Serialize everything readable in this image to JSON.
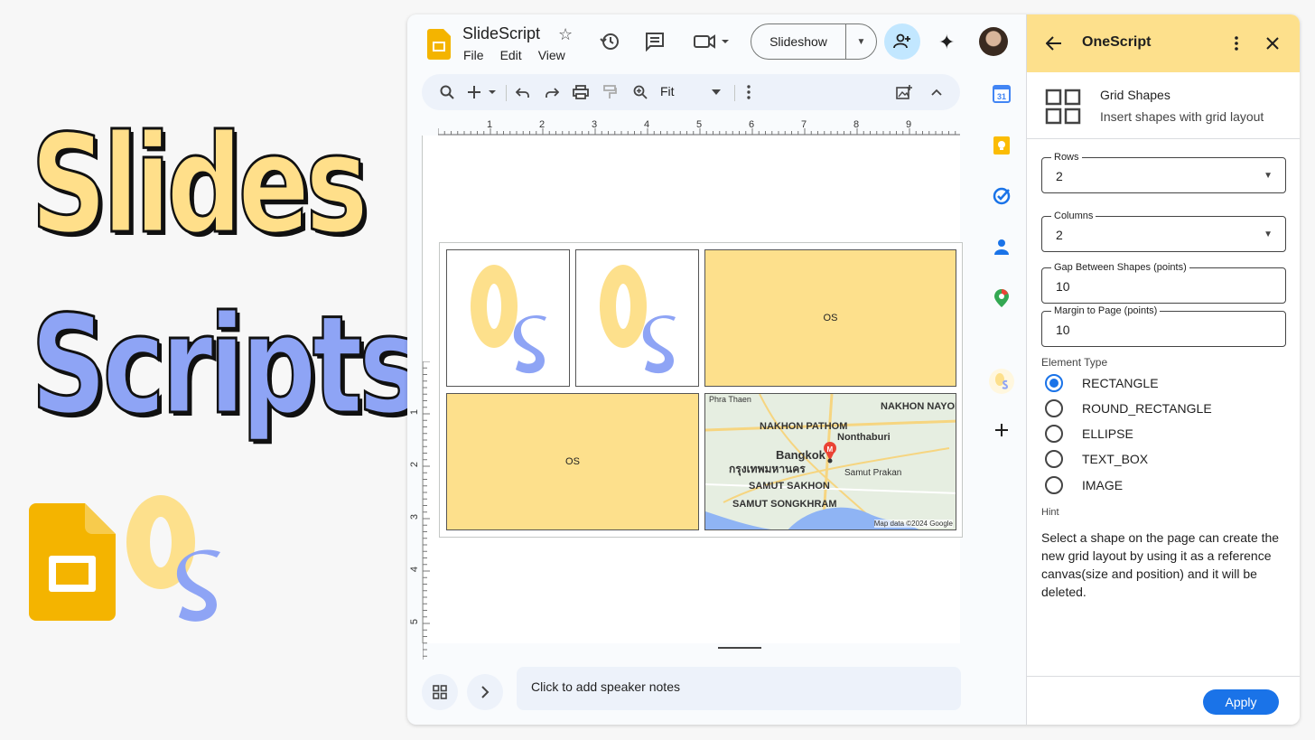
{
  "promo": {
    "word1": "Slides",
    "word2": "Scripts",
    "colors": {
      "yellow": "#ffdf8a",
      "blue": "#8ea4f5"
    }
  },
  "app": {
    "doc_title": "SlideScript",
    "menus": [
      "File",
      "Edit",
      "View"
    ],
    "slideshow_label": "Slideshow",
    "zoom_label": "Fit",
    "ruler_h": [
      "1",
      "2",
      "3",
      "4",
      "5",
      "6",
      "7",
      "8",
      "9"
    ],
    "ruler_v": [
      "1",
      "2",
      "3",
      "4",
      "5"
    ],
    "notes_placeholder": "Click to add speaker notes"
  },
  "slide": {
    "shape_text": "OS",
    "map": {
      "labels": [
        "Phra Thaen",
        "NAKHON PATHOM",
        "NAKHON NAYOK",
        "Nonthaburi",
        "Bangkok",
        "กรุงเทพมหานคร",
        "Samut Prakan",
        "SAMUT SAKHON",
        "SAMUT SONGKHRAM"
      ],
      "credit": "Map data ©2024 Google"
    }
  },
  "panel": {
    "title": "OneScript",
    "tool_title": "Grid Shapes",
    "tool_subtitle": "Insert shapes with grid layout",
    "rows": {
      "label": "Rows",
      "value": "2"
    },
    "columns": {
      "label": "Columns",
      "value": "2"
    },
    "gap": {
      "label": "Gap Between Shapes (points)",
      "value": "10"
    },
    "margin": {
      "label": "Margin to Page (points)",
      "value": "10"
    },
    "element_type_label": "Element Type",
    "element_types": [
      "RECTANGLE",
      "ROUND_RECTANGLE",
      "ELLIPSE",
      "TEXT_BOX",
      "IMAGE"
    ],
    "selected_type": "RECTANGLE",
    "hint_label": "Hint",
    "hint_text": "Select a shape on the page can create the new grid layout by using it as a reference canvas(size and position) and it will be deleted.",
    "apply_label": "Apply"
  },
  "icons": [
    "star-icon",
    "history-icon",
    "comment-icon",
    "video-icon",
    "share-icon",
    "gemini-icon",
    "search-icon",
    "add-icon",
    "undo-icon",
    "redo-icon",
    "print-icon",
    "paint-format-icon",
    "zoom-icon",
    "more-icon",
    "insert-image-icon",
    "collapse-icon",
    "back-icon",
    "close-icon",
    "grid-icon"
  ],
  "theme": {
    "accent": "#1a73e8",
    "panel_header": "#fde08c",
    "share": "#c2e7ff"
  }
}
